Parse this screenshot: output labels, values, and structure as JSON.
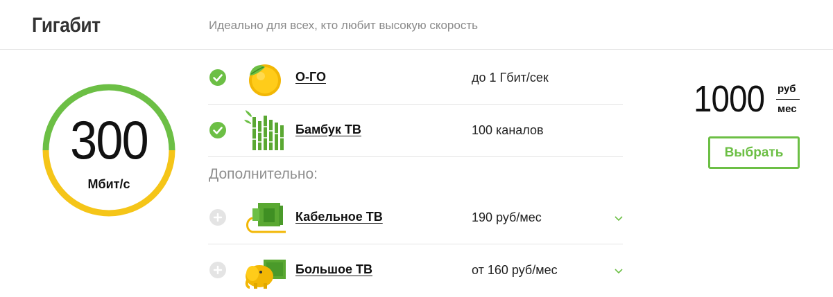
{
  "tariff": {
    "name": "Гигабит",
    "description": "Идеально для всех, кто любит высокую скорость"
  },
  "speed": {
    "value": "300",
    "unit": "Мбит/с"
  },
  "included": [
    {
      "name": "О-ГО",
      "value": "до 1 Гбит/сек",
      "icon": "orange-icon"
    },
    {
      "name": "Бамбук ТВ",
      "value": "100 каналов",
      "icon": "bamboo-icon"
    }
  ],
  "extra_label": "Дополнительно:",
  "extras": [
    {
      "name": "Кабельное ТВ",
      "value": "190 руб/мес",
      "icon": "cable-tv-icon"
    },
    {
      "name": "Большое ТВ",
      "value": "от 160 руб/мес",
      "icon": "elephant-tv-icon"
    }
  ],
  "price": {
    "amount": "1000",
    "currency": "руб",
    "period": "мес"
  },
  "select_button": "Выбрать",
  "colors": {
    "accent_green": "#6cbf45",
    "gauge_yellow": "#f5c518",
    "muted_text": "#8a8a8a"
  }
}
